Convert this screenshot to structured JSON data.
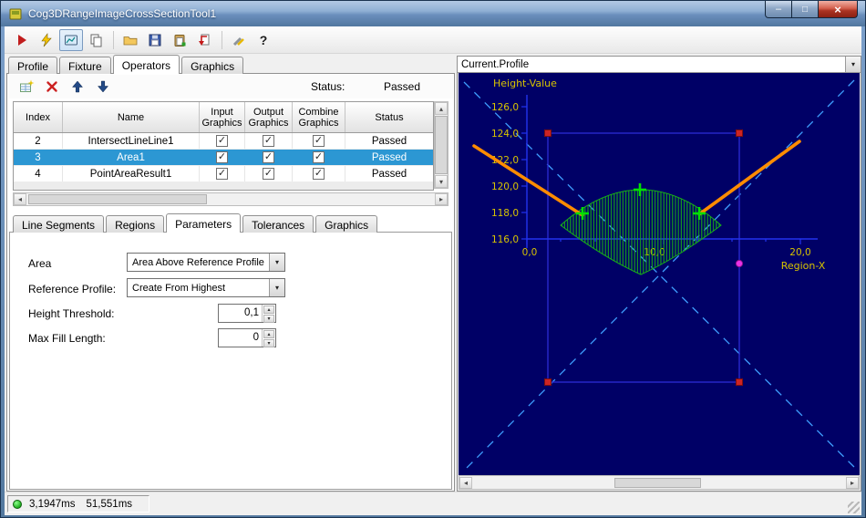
{
  "window": {
    "title": "Cog3DRangeImageCrossSectionTool1"
  },
  "icons": {
    "minimize": "–",
    "maximize": "□",
    "close": "×",
    "help": "?",
    "check": "✓",
    "dropdown": "▾",
    "arrow_up": "▴",
    "arrow_down": "▾",
    "arrow_left": "◂",
    "arrow_right": "▸"
  },
  "tabs": {
    "items": [
      "Profile",
      "Fixture",
      "Operators",
      "Graphics"
    ],
    "selected": "Operators"
  },
  "operators": {
    "status_label": "Status:",
    "status_value": "Passed",
    "table": {
      "headers": [
        "Index",
        "Name",
        "Input Graphics",
        "Output Graphics",
        "Combine Graphics",
        "Status"
      ],
      "rows": [
        {
          "index": "2",
          "name": "IntersectLineLine1",
          "input_graphics": true,
          "output_graphics": true,
          "combine_graphics": true,
          "status": "Passed"
        },
        {
          "index": "3",
          "name": "Area1",
          "input_graphics": true,
          "output_graphics": true,
          "combine_graphics": true,
          "status": "Passed"
        },
        {
          "index": "4",
          "name": "PointAreaResult1",
          "input_graphics": true,
          "output_graphics": true,
          "combine_graphics": true,
          "status": "Passed"
        }
      ],
      "selected_row": "Area1"
    }
  },
  "subtabs": {
    "items": [
      "Line Segments",
      "Regions",
      "Parameters",
      "Tolerances",
      "Graphics"
    ],
    "selected": "Parameters"
  },
  "parameters": {
    "area_label": "Area",
    "area_value": "Area Above Reference Profile",
    "reference_label": "Reference Profile:",
    "reference_value": "Create From Highest",
    "height_threshold_label": "Height Threshold:",
    "height_threshold_value": "0,1",
    "max_fill_label": "Max Fill Length:",
    "max_fill_value": "0"
  },
  "profile": {
    "selector": "Current.Profile",
    "y_axis_label": "Height-Value",
    "x_axis_label": "Region-X",
    "y_ticks": [
      "126,0",
      "124,0",
      "122,0",
      "120,0",
      "118,0",
      "116,0"
    ],
    "x_ticks": [
      "0,0",
      "10,0",
      "20,0"
    ]
  },
  "statusbar": {
    "time1": "3,1947ms",
    "time2": "51,551ms"
  },
  "colors": {
    "selection": "#2c97d3",
    "plot_background": "#000066",
    "axis_line": "#2233ee",
    "axis_text": "#d8c400",
    "diagonal": "#3f9fff",
    "region_outline": "#2828cc",
    "handle": "#cc2424",
    "reference_line": "#ff8c00",
    "profile_marker": "#00e000",
    "area_hatch": "#18a818",
    "point_marker": "#e832e8",
    "status_led": "#22aa22"
  }
}
